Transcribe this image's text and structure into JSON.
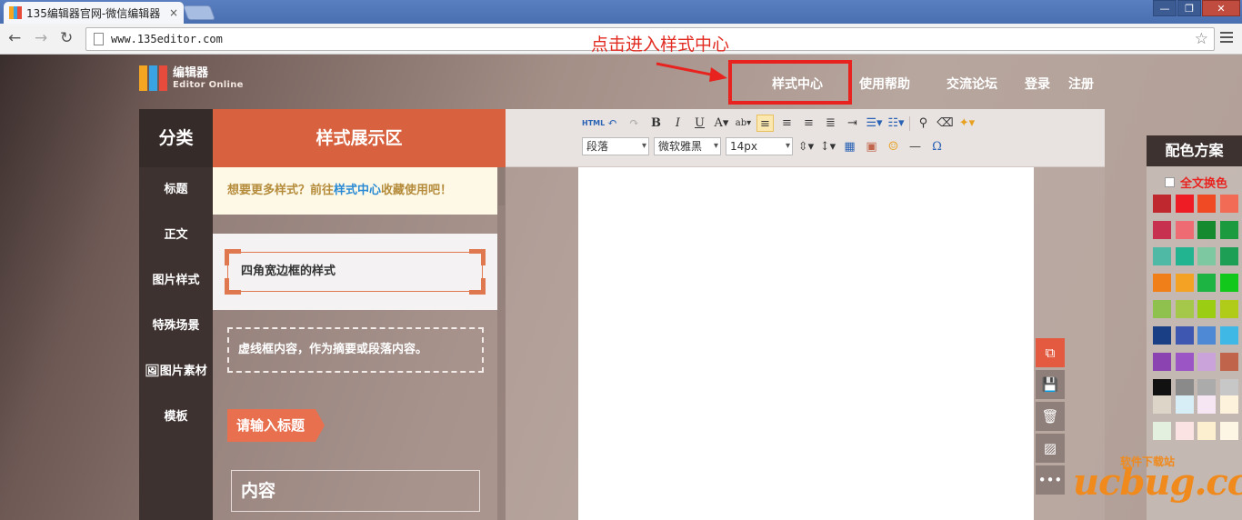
{
  "browser": {
    "tab_title": "135编辑器官网-微信编辑器",
    "tab_close": "×",
    "url": "www.135editor.com"
  },
  "annotation": "点击进入样式中心",
  "logo": {
    "cn": "编辑器",
    "en": "Editor Online",
    "colors": [
      "#f4a522",
      "#3aa3e3",
      "#e64b3c",
      "#8cc63f"
    ]
  },
  "topnav": [
    "样式中心",
    "使用帮助",
    "交流论坛",
    "登录",
    "注册"
  ],
  "categories": {
    "title": "分类",
    "items": [
      "标题",
      "正文",
      "图片样式",
      "特殊场景",
      "图片素材",
      "模板"
    ]
  },
  "styles": {
    "title": "样式展示区",
    "notice_prefix": "想要更多样式？前往",
    "notice_link": "样式中心",
    "notice_suffix": "收藏使用吧！",
    "corner_box": "四角宽边框的样式",
    "dashed_box": "虚线框内容，作为摘要或段落内容。",
    "title_tag": "请输入标题",
    "content_box": "内容"
  },
  "editor": {
    "paragraph_select": "段落",
    "font_select": "微软雅黑",
    "size_select": "14px"
  },
  "color_scheme": {
    "title": "配色方案",
    "checkbox_label": "全文换色",
    "swatches": [
      "#c0282f",
      "#ee1c24",
      "#f04a24",
      "#f26b55",
      "#c8304f",
      "#ef6b73",
      "#168a2f",
      "#1b9a3f",
      "#4fb9a6",
      "#22b391",
      "#7dc8a0",
      "#1e9f56",
      "#f07f19",
      "#f4a223",
      "#1db443",
      "#12c81a",
      "#8fc14f",
      "#a6c84a",
      "#9bcd13",
      "#b0cc18",
      "#1b3f84",
      "#3e57b0",
      "#4e89d6",
      "#3fb8e6",
      "#8a43b0",
      "#9b55c4",
      "#c9a3d9",
      "#c0654c",
      "#111111",
      "#8a8a8a",
      "#ababab",
      "#c7c7c7"
    ],
    "swatches_light": [
      "#ddd5c8",
      "#d8eef7",
      "#f6e6f4",
      "#fdf3dc",
      "#e3f0e0",
      "#fbe3e3",
      "#fcefd0",
      "#fdf6e5"
    ]
  },
  "watermark": {
    "main": "ucbug.cc",
    "sub": "软件下载站"
  }
}
